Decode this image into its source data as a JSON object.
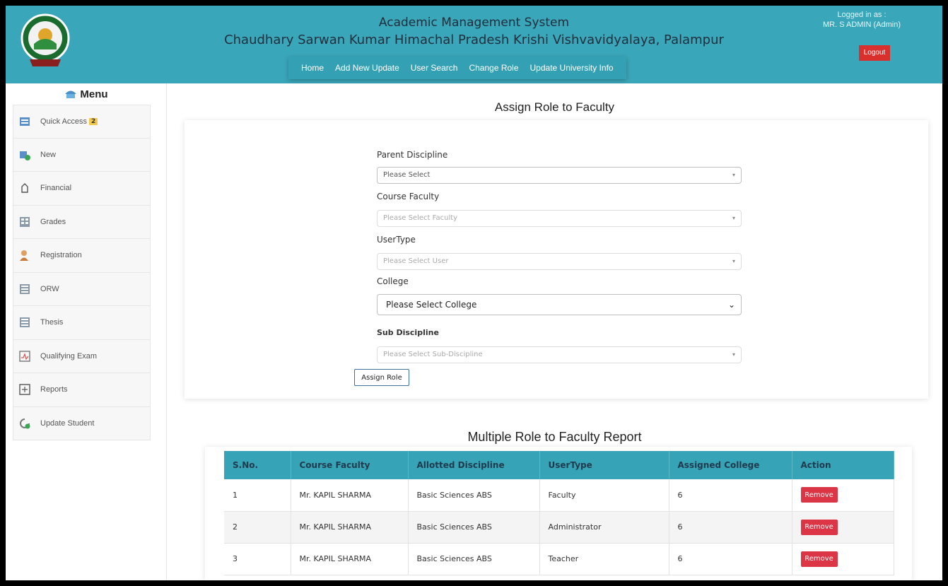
{
  "header": {
    "system_title": "Academic Management System",
    "university": "Chaudhary Sarwan Kumar Himachal Pradesh Krishi Vishvavidyalaya, Palampur",
    "logged_in_label": "Logged in as :",
    "user": "MR. S ADMIN (Admin)",
    "logout_label": "Logout",
    "nav": [
      "Home",
      "Add New Update",
      "User Search",
      "Change Role",
      "Update University Info"
    ]
  },
  "sidebar": {
    "title": "Menu",
    "items": [
      {
        "label": "Quick Access",
        "badge": "2",
        "icon": "quick-access-icon"
      },
      {
        "label": "New",
        "icon": "new-icon"
      },
      {
        "label": "Financial",
        "icon": "financial-icon"
      },
      {
        "label": "Grades",
        "icon": "grades-icon"
      },
      {
        "label": "Registration",
        "icon": "registration-icon"
      },
      {
        "label": "ORW",
        "icon": "orw-icon"
      },
      {
        "label": "Thesis",
        "icon": "thesis-icon"
      },
      {
        "label": "Qualifying Exam",
        "icon": "qualifying-exam-icon"
      },
      {
        "label": "Reports",
        "icon": "reports-icon"
      },
      {
        "label": "Update Student",
        "icon": "update-student-icon"
      }
    ]
  },
  "form": {
    "title": "Assign Role to Faculty",
    "parent_discipline_label": "Parent Discipline",
    "parent_discipline_value": "Please Select",
    "course_faculty_label": "Course Faculty",
    "course_faculty_value": "Please Select Faculty",
    "usertype_label": "UserType",
    "usertype_value": "Please Select User",
    "college_label": "College",
    "college_value": "Please Select College",
    "sub_discipline_label": "Sub Discipline",
    "sub_discipline_value": "Please Select Sub-Discipline",
    "assign_label": "Assign Role"
  },
  "report": {
    "title": "Multiple Role to Faculty Report",
    "columns": [
      "S.No.",
      "Course Faculty",
      "Allotted Discipline",
      "UserType",
      "Assigned College",
      "Action"
    ],
    "rows": [
      [
        "1",
        "Mr. KAPIL SHARMA",
        "Basic Sciences ABS",
        "Faculty",
        "6",
        "Remove"
      ],
      [
        "2",
        "Mr. KAPIL SHARMA",
        "Basic Sciences ABS",
        "Administrator",
        "6",
        "Remove"
      ],
      [
        "3",
        "Mr. KAPIL SHARMA",
        "Basic Sciences ABS",
        "Teacher",
        "6",
        "Remove"
      ]
    ]
  },
  "colors": {
    "header": "#3aa6b9",
    "table_header": "#36a3b6",
    "danger": "#dc3545"
  }
}
